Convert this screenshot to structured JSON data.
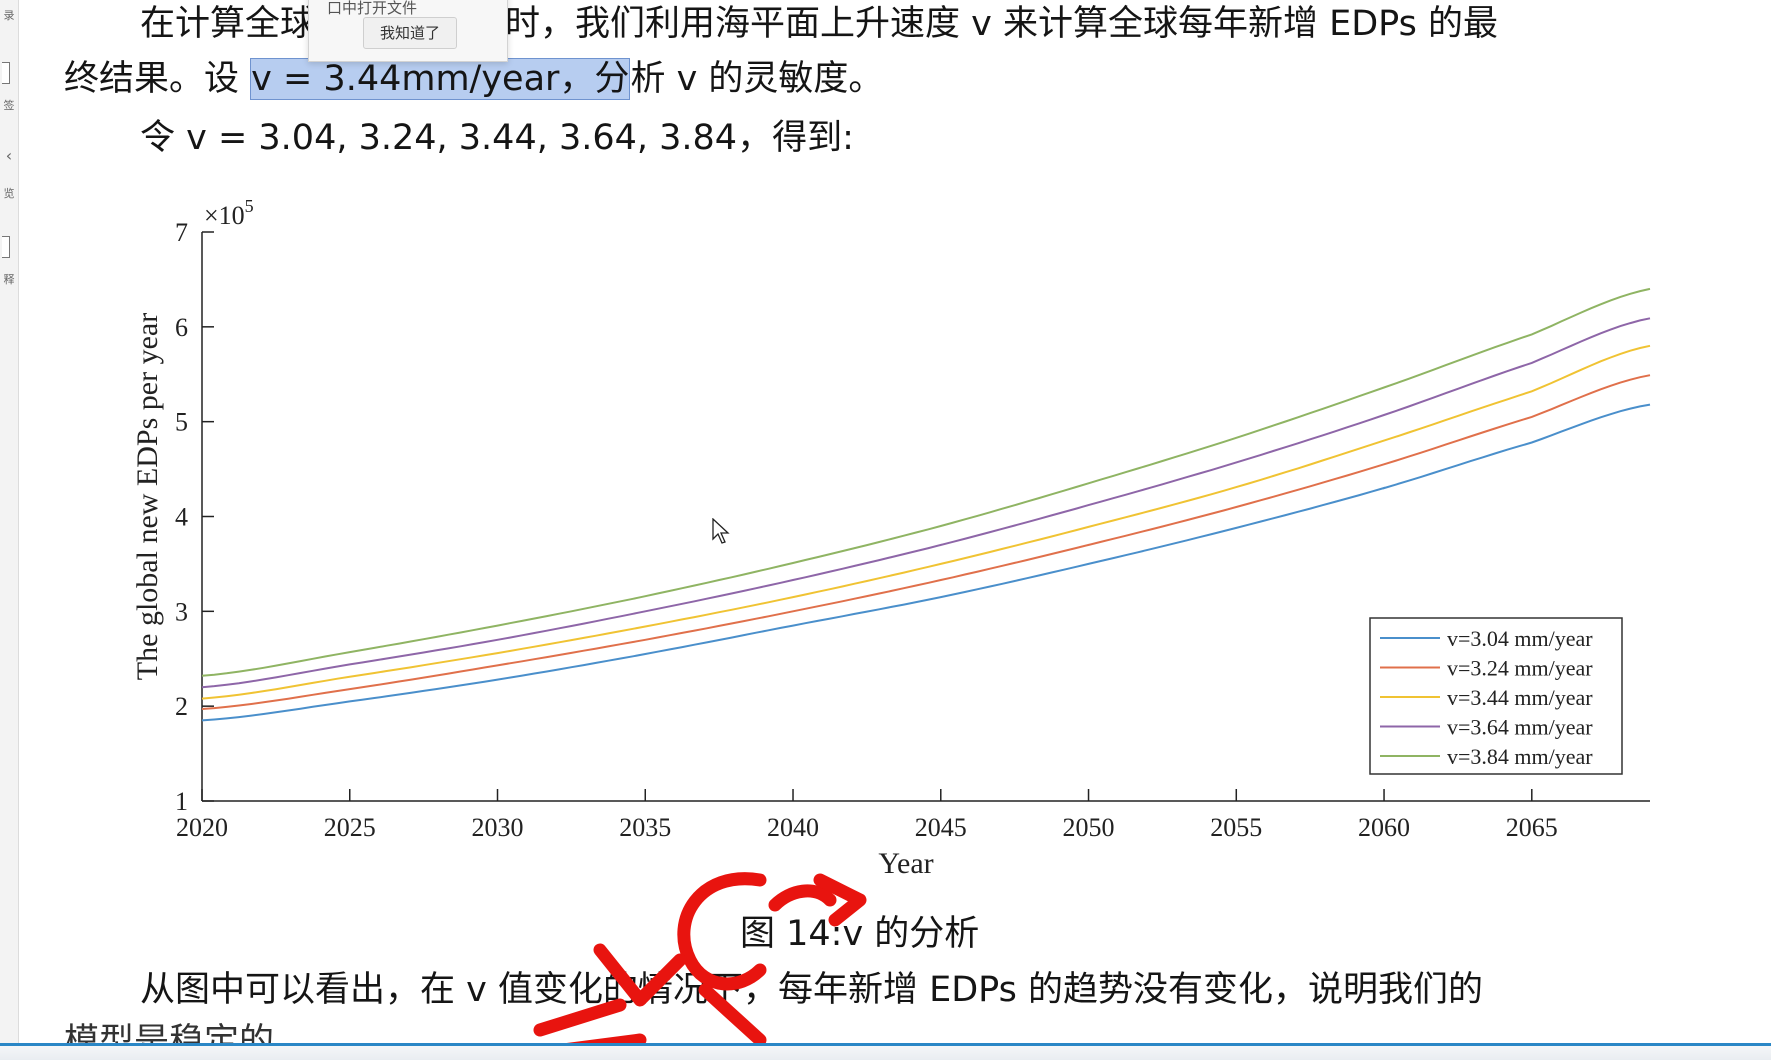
{
  "popup": {
    "title": "口中打开文件",
    "button_label": "我知道了"
  },
  "document": {
    "line1_prefix": "在计算全球",
    "line1_suffix": "时，我们利用海平面上升速度 v 来计算全球每年新增 EDPs 的最",
    "line2_prefix": "终结果。设 ",
    "line2_highlight": "v = 3.44mm/year，分",
    "line2_suffix": "析 v 的灵敏度。",
    "line3": "令 v = 3.04, 3.24, 3.44, 3.64, 3.84，得到:",
    "caption": "图 14:v 的分析",
    "line4": "从图中可以看出，在 v 值变化的情况下，每年新增 EDPs 的趋势没有变化，说明我们的",
    "line5": "模型是稳定的"
  },
  "left_strip": {
    "labels": [
      "录",
      "签",
      "览",
      "释"
    ]
  },
  "chart_data": {
    "type": "line",
    "xlabel": "Year",
    "ylabel": "The global new EDPs per year",
    "y_multiplier": "×10^5",
    "xlim": [
      2020,
      2069
    ],
    "ylim": [
      1,
      7
    ],
    "xticks": [
      2020,
      2025,
      2030,
      2035,
      2040,
      2045,
      2050,
      2055,
      2060,
      2065
    ],
    "yticks": [
      1,
      2,
      3,
      4,
      5,
      6,
      7
    ],
    "legend_position": "bottom-right",
    "grid": false,
    "x": [
      2020,
      2025,
      2030,
      2035,
      2040,
      2045,
      2050,
      2055,
      2060,
      2065,
      2069
    ],
    "series": [
      {
        "name": "v=3.04 mm/year",
        "color": "#4a8fcb",
        "values": [
          1.85,
          2.05,
          2.28,
          2.55,
          2.85,
          3.15,
          3.5,
          3.88,
          4.3,
          4.78,
          5.18
        ]
      },
      {
        "name": "v=3.24 mm/year",
        "color": "#e0704b",
        "values": [
          1.97,
          2.18,
          2.43,
          2.7,
          3.0,
          3.33,
          3.7,
          4.1,
          4.55,
          5.05,
          5.49
        ]
      },
      {
        "name": "v=3.44 mm/year",
        "color": "#f0c333",
        "values": [
          2.08,
          2.31,
          2.56,
          2.84,
          3.15,
          3.5,
          3.89,
          4.31,
          4.8,
          5.32,
          5.8
        ]
      },
      {
        "name": "v=3.64 mm/year",
        "color": "#8e66a8",
        "values": [
          2.2,
          2.44,
          2.7,
          3.0,
          3.33,
          3.7,
          4.12,
          4.57,
          5.07,
          5.62,
          6.09
        ]
      },
      {
        "name": "v=3.84 mm/year",
        "color": "#8fb463",
        "values": [
          2.32,
          2.57,
          2.85,
          3.16,
          3.51,
          3.9,
          4.35,
          4.83,
          5.36,
          5.92,
          6.4
        ]
      }
    ]
  }
}
